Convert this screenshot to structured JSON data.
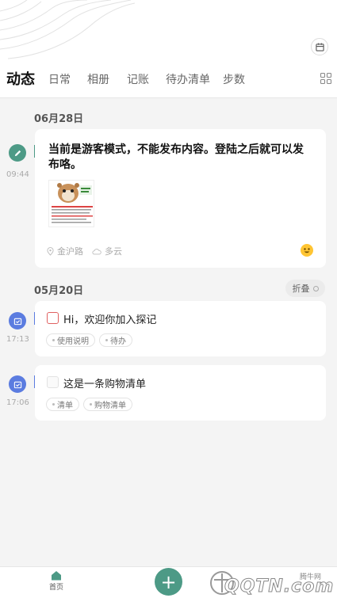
{
  "header": {
    "calendar_icon": "calendar-icon",
    "grid_icon": "grid-icon",
    "tabs": [
      {
        "label": "动态",
        "active": true
      },
      {
        "label": "日常"
      },
      {
        "label": "相册"
      },
      {
        "label": "记账"
      },
      {
        "label": "待办清单"
      },
      {
        "label": "步数"
      }
    ]
  },
  "sections": [
    {
      "date": "06月28日",
      "entries": [
        {
          "type": "post",
          "time": "09:44",
          "icon": "pencil-icon",
          "text": "当前是游客模式，不能发布内容。登陆之后就可以发布咯。",
          "location": "金沪路",
          "weather": "多云",
          "mood_icon": "smiley-emoji-icon"
        }
      ]
    },
    {
      "date": "05月20日",
      "fold_label": "折叠",
      "entries": [
        {
          "type": "todo",
          "time": "17:13",
          "icon": "calendar-check-icon",
          "text": "Hi，欢迎你加入探记",
          "tags": [
            "使用说明",
            "待办"
          ]
        },
        {
          "type": "todo",
          "time": "17:06",
          "icon": "calendar-check-icon",
          "text": "这是一条购物清单",
          "tags": [
            "清单",
            "购物清单"
          ]
        }
      ]
    }
  ],
  "bottom_nav": {
    "home_label": "首页",
    "add_label": "+"
  },
  "watermark": {
    "small": "腾牛网",
    "big": "QQTN.com"
  },
  "colors": {
    "accent": "#4d9a86",
    "timeline_blue": "#5b7ce0",
    "todo_red": "#e06060"
  }
}
